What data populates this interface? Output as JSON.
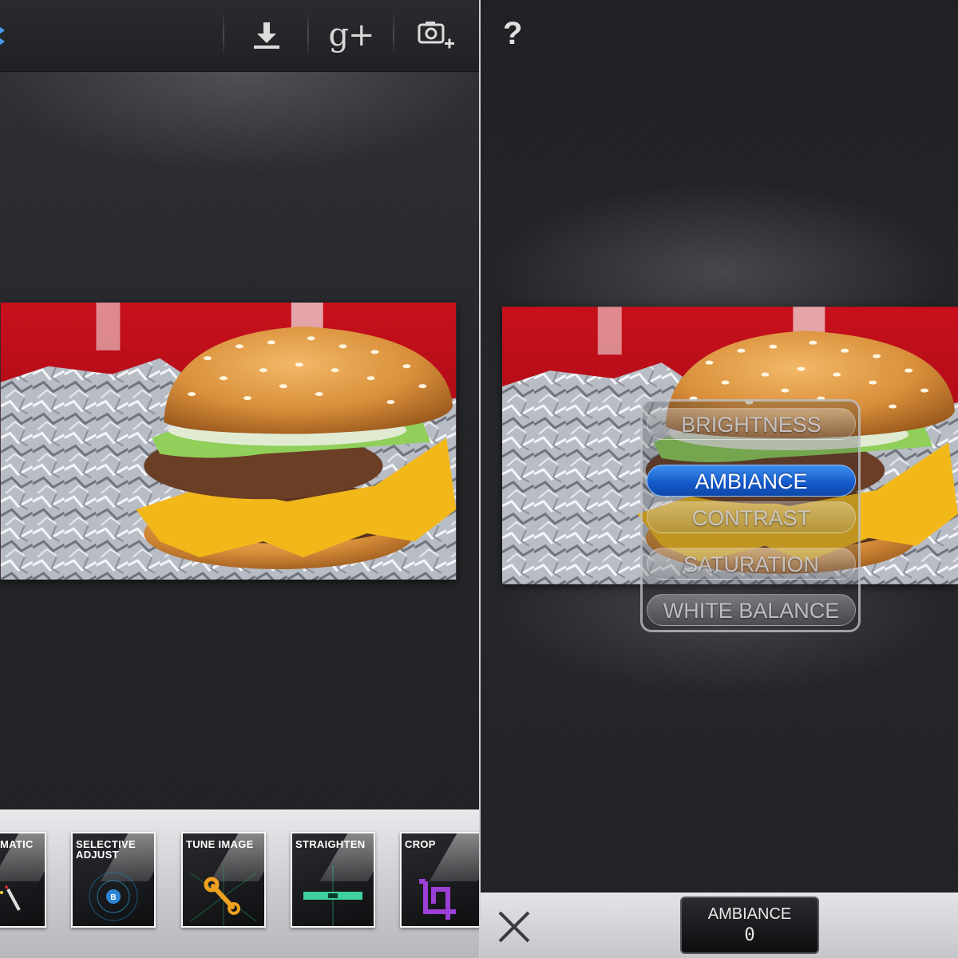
{
  "left_panel": {
    "toolbar": {
      "download_icon": "download-icon",
      "share_label": "g+",
      "camera_icon": "add-photo-icon"
    },
    "photo_description": "burger-photo",
    "tools": [
      {
        "label": "MATIC",
        "icon": "magic-wand-icon"
      },
      {
        "label": "SELECTIVE ADJUST",
        "icon": "selective-point-icon"
      },
      {
        "label": "TUNE IMAGE",
        "icon": "wrench-icon"
      },
      {
        "label": "STRAIGHTEN",
        "icon": "level-icon"
      },
      {
        "label": "CROP",
        "icon": "crop-icon"
      }
    ]
  },
  "right_panel": {
    "help_label": "?",
    "filter_menu": {
      "items": [
        "BRIGHTNESS",
        "AMBIANCE",
        "CONTRAST",
        "SATURATION",
        "WHITE BALANCE"
      ],
      "selected": "AMBIANCE"
    },
    "bottom_bar": {
      "close_icon": "close-icon",
      "value_label": "AMBIANCE",
      "value": "0"
    }
  },
  "colors": {
    "accent_blue": "#1a66d6",
    "crop_purple": "#9b3fd6",
    "wrench_orange": "#f0a020",
    "level_green": "#3fd0a0"
  }
}
